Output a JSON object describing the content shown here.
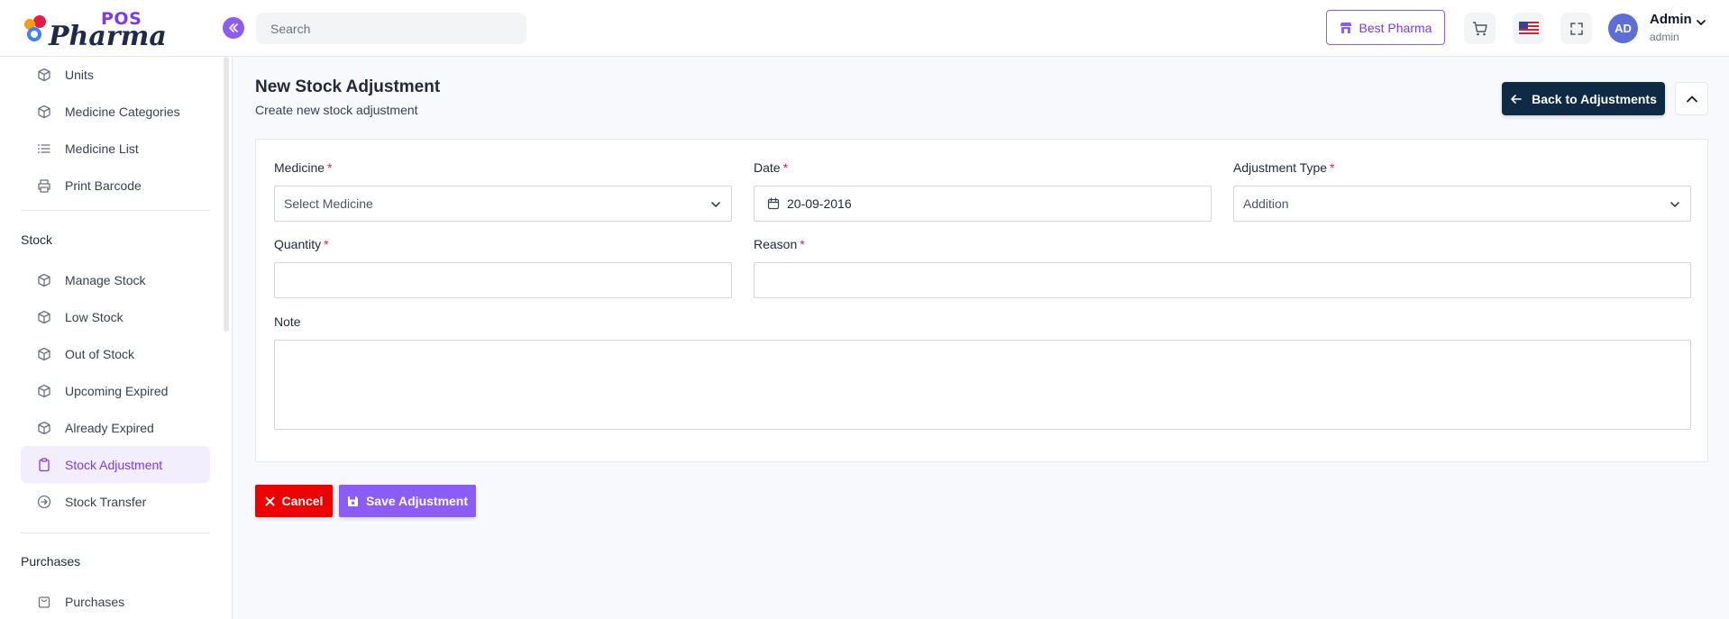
{
  "brand": {
    "logo_top": "POS",
    "logo_main": "Pharma",
    "accent": "#8b5cf6"
  },
  "header": {
    "search_placeholder": "Search",
    "store_label": "Best Pharma",
    "user_initials": "AD",
    "user_name": "Admin",
    "user_role": "admin"
  },
  "sidebar": {
    "items_top": [
      {
        "label": "Units",
        "icon": "box-icon"
      },
      {
        "label": "Medicine Categories",
        "icon": "box-icon"
      },
      {
        "label": "Medicine List",
        "icon": "list-icon"
      },
      {
        "label": "Print Barcode",
        "icon": "printer-icon"
      }
    ],
    "section_stock": "Stock",
    "items_stock": [
      {
        "label": "Manage Stock",
        "icon": "box-icon"
      },
      {
        "label": "Low Stock",
        "icon": "box-icon"
      },
      {
        "label": "Out of Stock",
        "icon": "box-icon"
      },
      {
        "label": "Upcoming Expired",
        "icon": "box-icon"
      },
      {
        "label": "Already Expired",
        "icon": "box-icon"
      },
      {
        "label": "Stock Adjustment",
        "icon": "clipboard-icon",
        "active": true
      },
      {
        "label": "Stock Transfer",
        "icon": "arrow-circle-icon"
      }
    ],
    "section_purchases": "Purchases",
    "items_purchases": [
      {
        "label": "Purchases",
        "icon": "bag-icon"
      }
    ]
  },
  "main": {
    "title": "New Stock Adjustment",
    "subtitle": "Create new stock adjustment",
    "back_label": "Back to Adjustments",
    "form": {
      "medicine_label": "Medicine",
      "medicine_placeholder": "Select Medicine",
      "date_label": "Date",
      "date_value": "20-09-2016",
      "type_label": "Adjustment Type",
      "type_value": "Addition",
      "quantity_label": "Quantity",
      "quantity_value": "",
      "reason_label": "Reason",
      "reason_value": "",
      "note_label": "Note",
      "note_value": "",
      "required_mark": "*"
    },
    "cancel_label": "Cancel",
    "save_label": "Save Adjustment"
  }
}
